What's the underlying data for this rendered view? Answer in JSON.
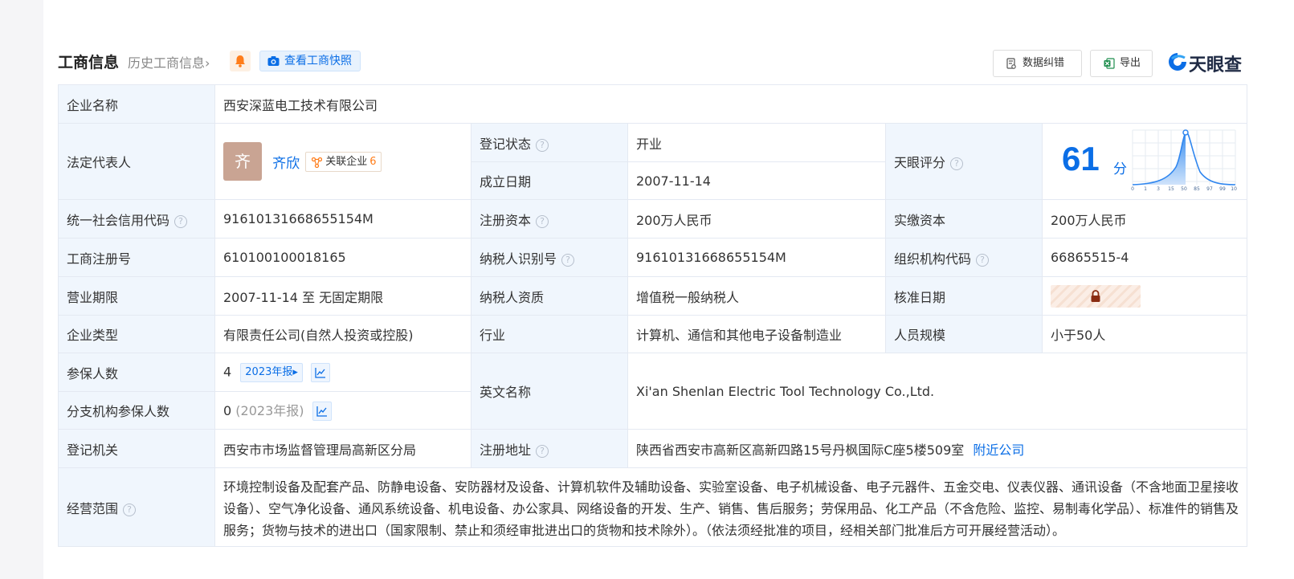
{
  "header": {
    "title": "工商信息",
    "history_label": "历史工商信息",
    "history_arrow": "›",
    "snapshot_label": "查看工商快照",
    "data_error_label": "数据纠错",
    "export_label": "导出",
    "logo_text": "天眼查"
  },
  "info": {
    "company_name": {
      "label": "企业名称",
      "value": "西安深蓝电工技术有限公司"
    },
    "legal_rep": {
      "label": "法定代表人",
      "avatar_char": "齐",
      "name": "齐欣",
      "related_label": "关联企业",
      "related_count": "6"
    },
    "status": {
      "label": "登记状态",
      "value": "开业"
    },
    "founded": {
      "label": "成立日期",
      "value": "2007-11-14"
    },
    "tianyan_score": {
      "label": "天眼评分",
      "value": "61",
      "unit": "分",
      "chart_ticks": [
        "0",
        "1",
        "3",
        "15",
        "50",
        "85",
        "97",
        "99",
        "100"
      ]
    },
    "credit_code": {
      "label": "统一社会信用代码",
      "value": "91610131668655154M"
    },
    "reg_capital": {
      "label": "注册资本",
      "value": "200万人民币"
    },
    "paid_capital": {
      "label": "实缴资本",
      "value": "200万人民币"
    },
    "reg_number": {
      "label": "工商注册号",
      "value": "610100100018165"
    },
    "taxpayer_id": {
      "label": "纳税人识别号",
      "value": "91610131668655154M"
    },
    "org_code": {
      "label": "组织机构代码",
      "value": "66865515-4"
    },
    "term": {
      "label": "营业期限",
      "value": "2007-11-14 至 无固定期限"
    },
    "tax_quality": {
      "label": "纳税人资质",
      "value": "增值税一般纳税人"
    },
    "approve_date": {
      "label": "核准日期"
    },
    "company_type": {
      "label": "企业类型",
      "value": "有限责任公司(自然人投资或控股)"
    },
    "industry": {
      "label": "行业",
      "value": "计算机、通信和其他电子设备制造业"
    },
    "staff_size": {
      "label": "人员规模",
      "value": "小于50人"
    },
    "insured": {
      "label": "参保人数",
      "value": "4",
      "report_tag": "2023年报▸"
    },
    "english_name": {
      "label": "英文名称",
      "value": "Xi'an Shenlan Electric Tool Technology Co.,Ltd."
    },
    "branch_insured": {
      "label": "分支机构参保人数",
      "value": "0",
      "report_note": "(2023年报)"
    },
    "reg_authority": {
      "label": "登记机关",
      "value": "西安市市场监督管理局高新区分局"
    },
    "reg_address": {
      "label": "注册地址",
      "value": "陕西省西安市高新区高新四路15号丹枫国际C座5楼509室",
      "nearby_label": "附近公司"
    },
    "scope": {
      "label": "经营范围",
      "value": "环境控制设备及配套产品、防静电设备、安防器材及设备、计算机软件及辅助设备、实验室设备、电子机械设备、电子元器件、五金交电、仪表仪器、通讯设备（不含地面卫星接收设备）、空气净化设备、通风系统设备、机电设备、办公家具、网络设备的开发、生产、销售、售后服务；劳保用品、化工产品（不含危险、监控、易制毒化学品）、标准件的销售及服务；货物与技术的进出口（国家限制、禁止和须经审批进出口的货物和技术除外）。（依法须经批准的项目，经相关部门批准后方可开展经营活动）。"
    }
  },
  "colors": {
    "accent": "#0b6ee6",
    "label_bg": "#f0f6fd",
    "status_green": "#1a9c4a",
    "orange": "#ff7d1a"
  }
}
